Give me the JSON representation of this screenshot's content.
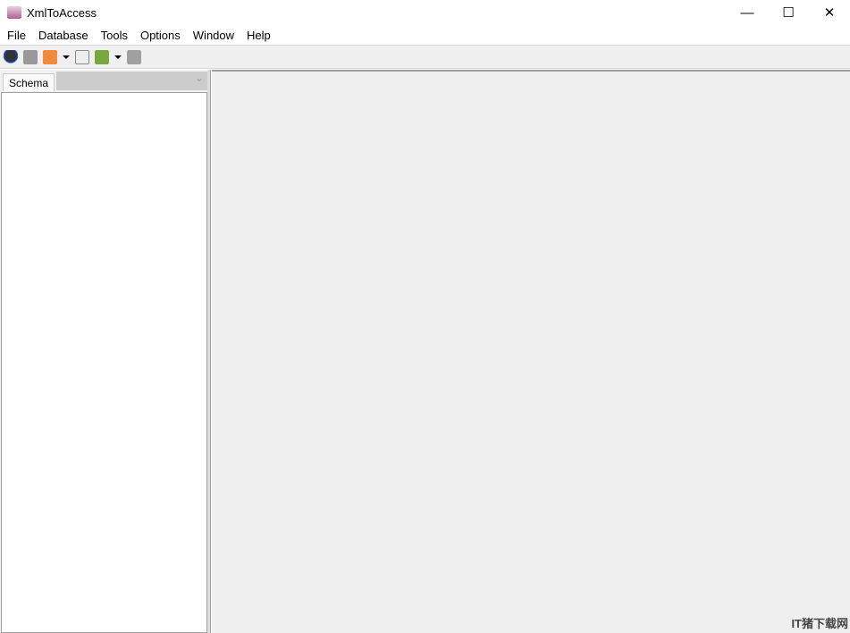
{
  "window": {
    "title": "XmlToAccess",
    "minimize": "—",
    "maximize": "☐",
    "close": "✕"
  },
  "menu": [
    "File",
    "Database",
    "Tools",
    "Options",
    "Window",
    "Help"
  ],
  "toolbar": [
    "user-icon",
    "connect-icon",
    "xml-icon",
    "map-icon",
    "window-icon",
    "stop-icon"
  ],
  "left_panel": {
    "tab": "Schema",
    "combo_value": ""
  },
  "watermark": "IT猪下载网"
}
